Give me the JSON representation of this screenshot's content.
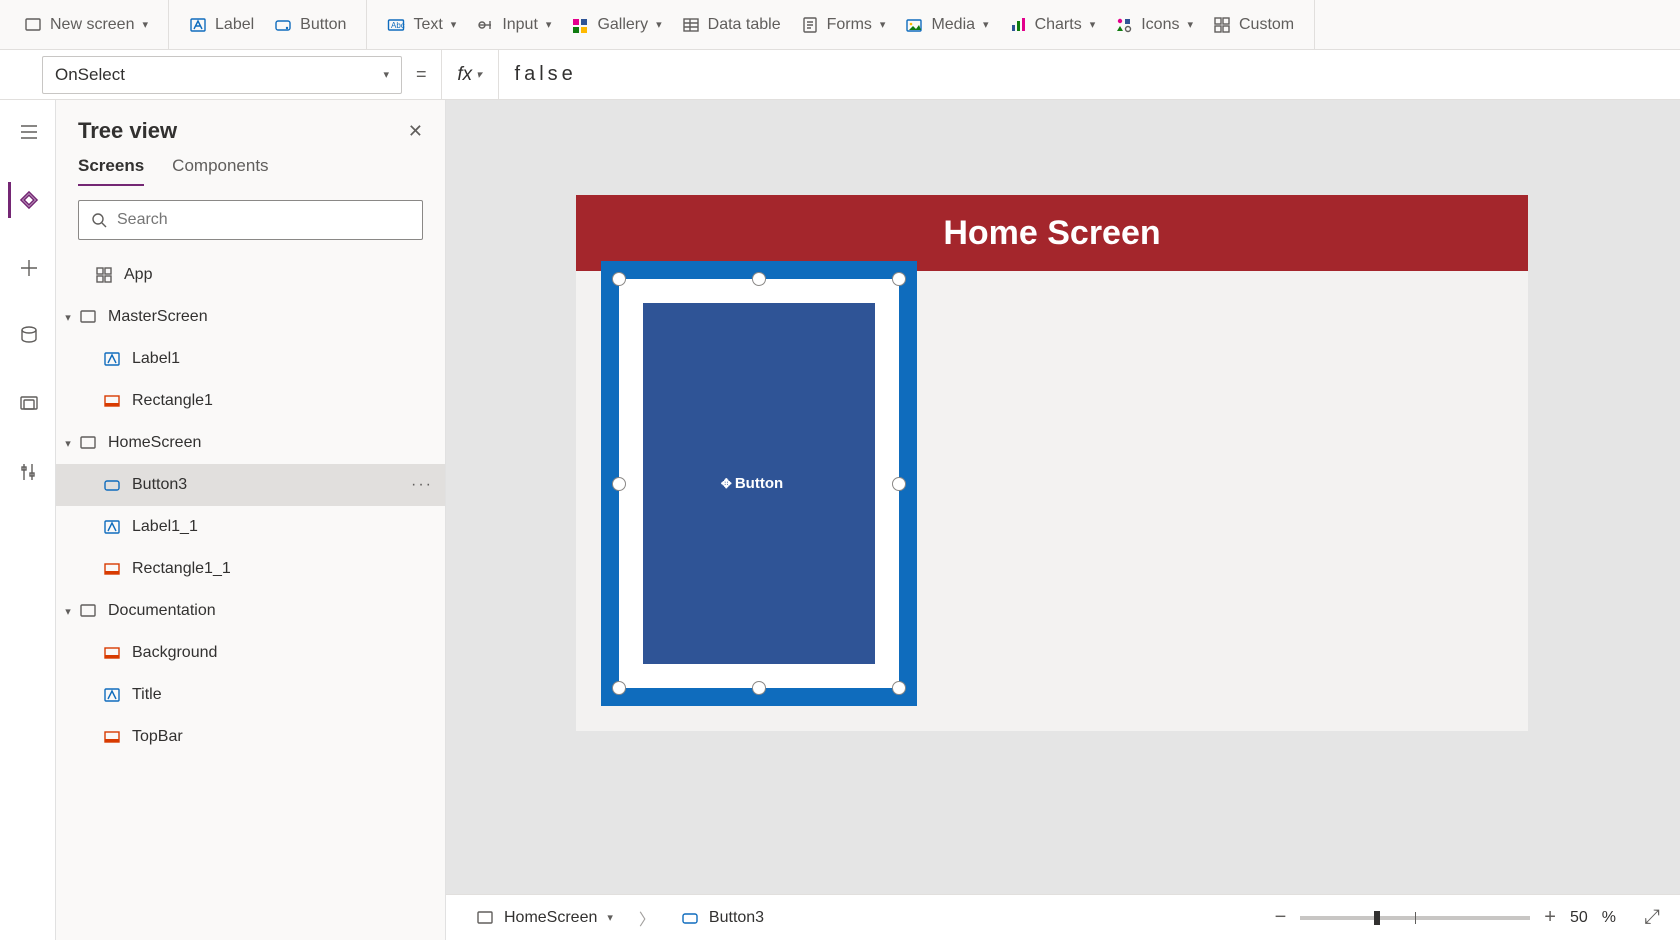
{
  "ribbon": {
    "new_screen": "New screen",
    "label": "Label",
    "button": "Button",
    "text": "Text",
    "input": "Input",
    "gallery": "Gallery",
    "data_table": "Data table",
    "forms": "Forms",
    "media": "Media",
    "charts": "Charts",
    "icons": "Icons",
    "custom": "Custom"
  },
  "property_selector": "OnSelect",
  "formula_value": "false",
  "tree": {
    "title": "Tree view",
    "tabs": {
      "screens": "Screens",
      "components": "Components"
    },
    "search_placeholder": "Search",
    "nodes": {
      "app": "App",
      "master": "MasterScreen",
      "label1": "Label1",
      "rect1": "Rectangle1",
      "home": "HomeScreen",
      "button3": "Button3",
      "label1_1": "Label1_1",
      "rect1_1": "Rectangle1_1",
      "doc": "Documentation",
      "background": "Background",
      "title": "Title",
      "topbar": "TopBar"
    }
  },
  "canvas": {
    "banner_title": "Home Screen",
    "selected_control_text": "Button"
  },
  "status": {
    "crumb_screen": "HomeScreen",
    "crumb_item": "Button3",
    "zoom_value": "50",
    "zoom_unit": "%"
  }
}
